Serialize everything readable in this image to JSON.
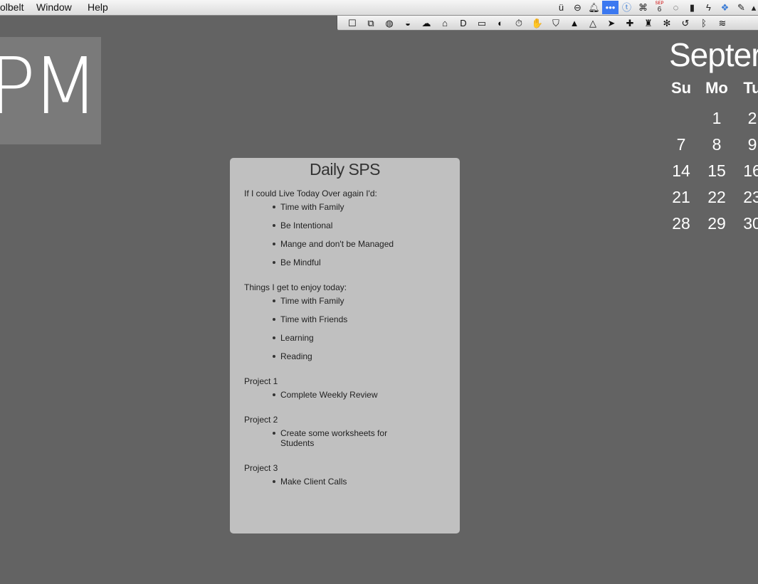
{
  "menubar": {
    "items": [
      "olbelt",
      "Window",
      "Help"
    ],
    "status_icons": [
      "tuneup-icon",
      "no-entry-icon",
      "bell-icon",
      "dots-icon",
      "te-icon",
      "grid-icon",
      "calendar-date-icon",
      "timer-icon",
      "bookmark-icon",
      "lightning-icon",
      "dropbox-icon",
      "evernote-icon",
      "partial-icon"
    ],
    "calendar_icon_month": "SEP",
    "calendar_icon_day": "6"
  },
  "iconbar": {
    "icons": [
      "square-icon",
      "screen-icon",
      "globe-icon",
      "pocket-icon",
      "cloud-icon",
      "bank-icon",
      "d-icon",
      "airplay-icon",
      "toggle-icon",
      "stopwatch-icon",
      "hand-icon",
      "shield-icon",
      "adobe-icon",
      "drive-icon",
      "arrow-icon",
      "plus-icon",
      "broom-icon",
      "paw-icon",
      "time-machine-icon",
      "bluetooth-icon",
      "wifi-icon"
    ]
  },
  "clock": {
    "text": "PM"
  },
  "calendar": {
    "month": "Septer",
    "days_header": [
      "Su",
      "Mo",
      "Tu"
    ],
    "weeks": [
      [
        "",
        "1",
        "2"
      ],
      [
        "7",
        "8",
        "9"
      ],
      [
        "14",
        "15",
        "16"
      ],
      [
        "21",
        "22",
        "23"
      ],
      [
        "28",
        "29",
        "30"
      ]
    ]
  },
  "card": {
    "title": "Daily SPS",
    "sections": [
      {
        "heading": "If I could Live Today Over again I'd:",
        "items": [
          "Time with Family",
          "Be Intentional",
          "Mange and don't be Managed",
          "Be Mindful"
        ]
      },
      {
        "heading": "Things I get to enjoy today:",
        "items": [
          "Time with Family",
          "Time with Friends",
          "Learning",
          "Reading"
        ]
      },
      {
        "heading": "Project 1",
        "items": [
          "Complete Weekly Review"
        ]
      },
      {
        "heading": "Project 2",
        "items": [
          "Create some worksheets for Students"
        ]
      },
      {
        "heading": "Project 3",
        "items": [
          "Make Client Calls"
        ]
      }
    ]
  }
}
